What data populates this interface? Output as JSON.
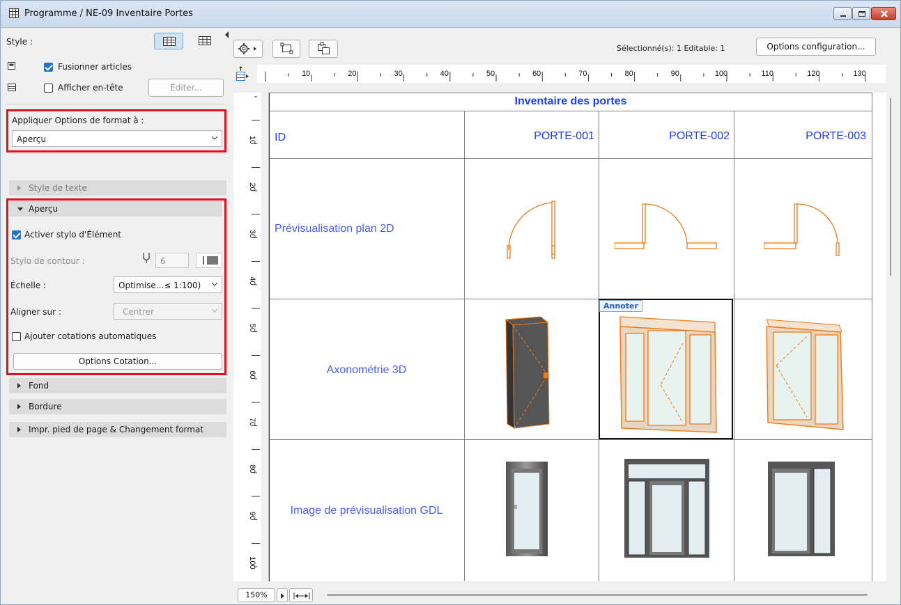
{
  "window": {
    "title": "Programme / NE-09 Inventaire Portes"
  },
  "left_panel": {
    "style_label": "Style :",
    "merge_items": {
      "label": "Fusionner articles",
      "checked": true
    },
    "show_header": {
      "label": "Afficher en-tête",
      "checked": false
    },
    "edit_button": "Éditer...",
    "apply_format_label": "Appliquer Options de format à :",
    "apply_format_value": "Aperçu",
    "sections": {
      "text_style": "Style de texte",
      "preview": "Aperçu",
      "background": "Fond",
      "border": "Bordure",
      "footer": "Impr. pied de page & Changement format"
    },
    "activate_pen": {
      "label": "Activer stylo d'Élément",
      "checked": true
    },
    "contour_pen_label": "Stylo de contour :",
    "contour_pen_value": "6",
    "scale_label": "Échelle :",
    "scale_value": "Optimise...≤ 1:100)",
    "align_label": "Aligner sur :",
    "align_value": "Centrer",
    "auto_dims": {
      "label": "Ajouter cotations automatiques",
      "checked": false
    },
    "dim_options_button": "Options Cotation..."
  },
  "toolbar": {
    "selected_status": "Sélectionné(s): 1  Editable: 1",
    "config_button": "Options configuration..."
  },
  "ruler": {
    "h_labels": [
      "10",
      "20",
      "30",
      "40",
      "50",
      "60",
      "70",
      "80",
      "90",
      "100",
      "110",
      "120",
      "130"
    ],
    "v_labels": [
      "10",
      "20",
      "30",
      "40",
      "50",
      "60",
      "70",
      "80",
      "90",
      "100"
    ]
  },
  "schedule": {
    "title": "Inventaire des portes",
    "id_label": "ID",
    "ids": [
      "PORTE-001",
      "PORTE-002",
      "PORTE-003"
    ],
    "rows": {
      "plan2d": "Prévisualisation plan 2D",
      "axo3d": "Axonométrie 3D",
      "gdl": "Image de prévisualisation GDL"
    },
    "annotate_tag": "Annoter"
  },
  "status": {
    "zoom": "150%"
  },
  "colors": {
    "accent_red": "#e0101c",
    "schedule_text": "#1f3ff0",
    "door_orange": "#f07a16"
  }
}
